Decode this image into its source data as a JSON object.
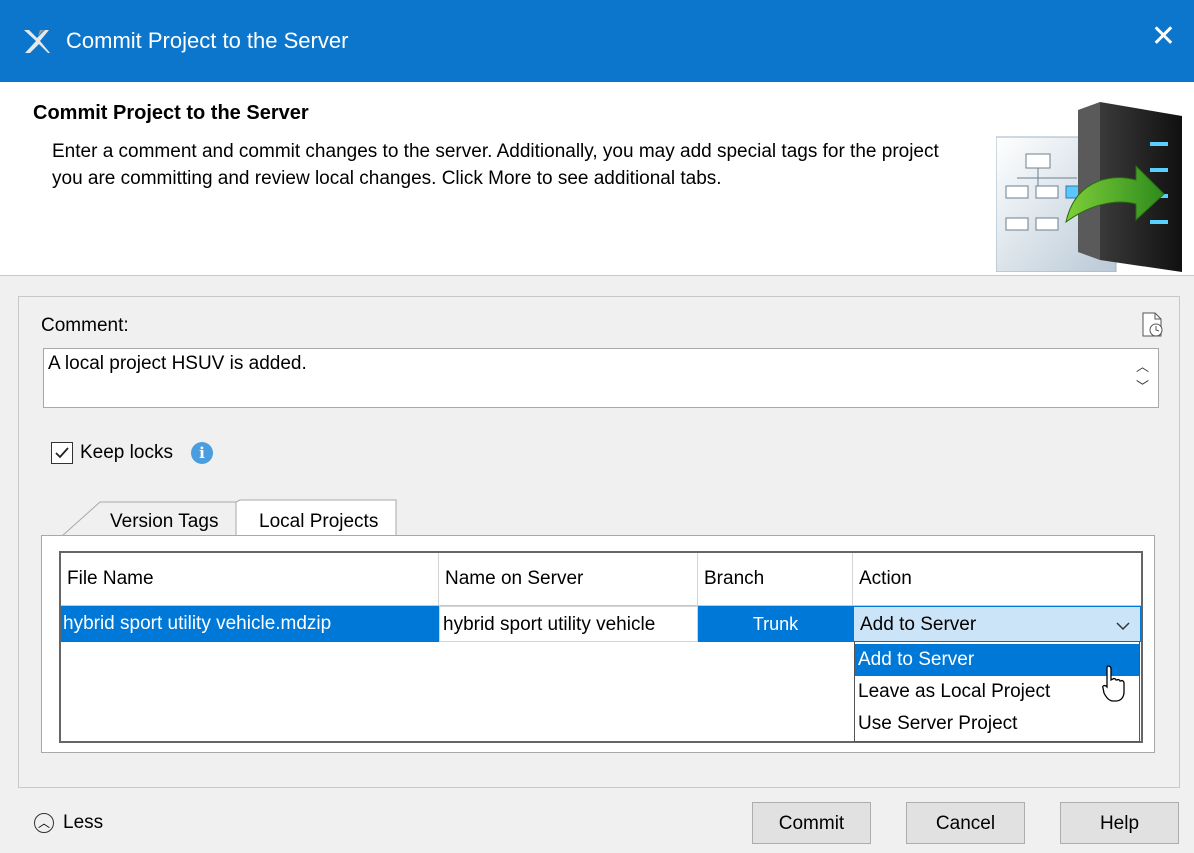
{
  "window": {
    "title": "Commit Project to the Server",
    "close_glyph": "✕",
    "app_icon": "magicdraw-icon"
  },
  "header": {
    "title": "Commit Project to the Server",
    "description": "Enter a comment and commit changes to the server. Additionally, you may add special tags for the project you are committing and review local changes. Click More to see additional tabs."
  },
  "comment": {
    "label": "Comment:",
    "value": "A local project HSUV is added."
  },
  "keep_locks": {
    "label": "Keep locks",
    "checked": true
  },
  "tabs": [
    {
      "label": "Version Tags"
    },
    {
      "label": "Local Projects"
    }
  ],
  "table": {
    "columns": [
      "File Name",
      "Name on Server",
      "Branch",
      "Action"
    ],
    "rows": [
      {
        "file_name": "hybrid sport utility vehicle.mdzip",
        "name_on_server": "hybrid sport utility vehicle",
        "branch": "Trunk",
        "action": "Add to Server"
      }
    ]
  },
  "action_dropdown": {
    "options": [
      "Add to Server",
      "Leave as Local Project",
      "Use Server Project"
    ],
    "highlighted": "Add to Server"
  },
  "footer": {
    "less_label": "Less",
    "commit_label": "Commit",
    "cancel_label": "Cancel",
    "help_label": "Help"
  },
  "colors": {
    "title_bar": "#0c76cc",
    "selection": "#0078d7",
    "combo_bg": "#cce4f7"
  }
}
